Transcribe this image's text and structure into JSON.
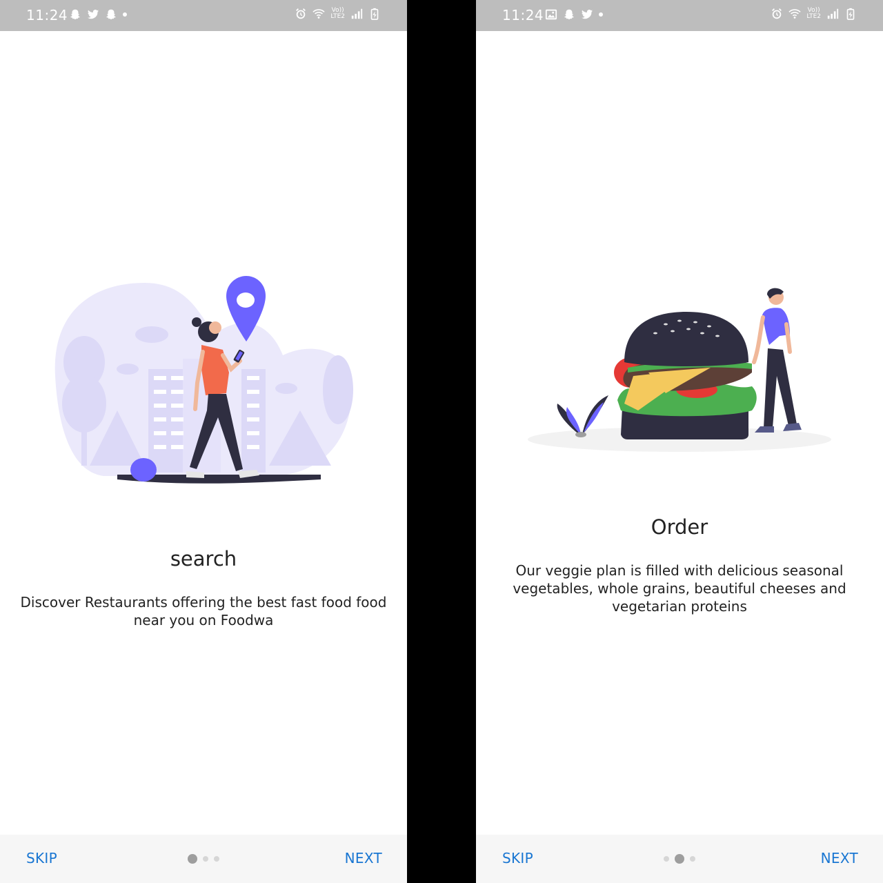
{
  "screens": [
    {
      "status": {
        "time": "11:24",
        "network": "LTE2",
        "volte": "Vo))"
      },
      "title": "search",
      "description": "Discover Restaurants offering the best fast food food near you on Foodwa",
      "skip_label": "SKIP",
      "next_label": "NEXT",
      "page_indicator": {
        "current": 1,
        "total": 3
      },
      "illustration": "woman-walking-with-map-pin",
      "status_icons_left": [
        "snapchat-icon",
        "twitter-icon",
        "snapchat-icon",
        "dot"
      ],
      "status_icons_right": [
        "alarm-icon",
        "wifi-icon",
        "lte-icon",
        "signal-icon",
        "battery-charging-icon"
      ]
    },
    {
      "status": {
        "time": "11:24",
        "network": "LTE2",
        "volte": "Vo))"
      },
      "title": "Order",
      "description": "Our veggie plan is filled with delicious seasonal vegetables, whole grains, beautiful cheeses and vegetarian proteins",
      "skip_label": "SKIP",
      "next_label": "NEXT",
      "page_indicator": {
        "current": 2,
        "total": 3
      },
      "illustration": "man-standing-beside-giant-burger",
      "status_icons_left": [
        "image-icon",
        "snapchat-icon",
        "twitter-icon",
        "dot"
      ],
      "status_icons_right": [
        "alarm-icon",
        "wifi-icon",
        "lte-icon",
        "signal-icon",
        "battery-charging-icon"
      ]
    }
  ],
  "colors": {
    "accent": "#1976d2",
    "illustration_primary": "#6c63ff",
    "statusbar": "#bdbdbd",
    "divider": "#000000"
  }
}
